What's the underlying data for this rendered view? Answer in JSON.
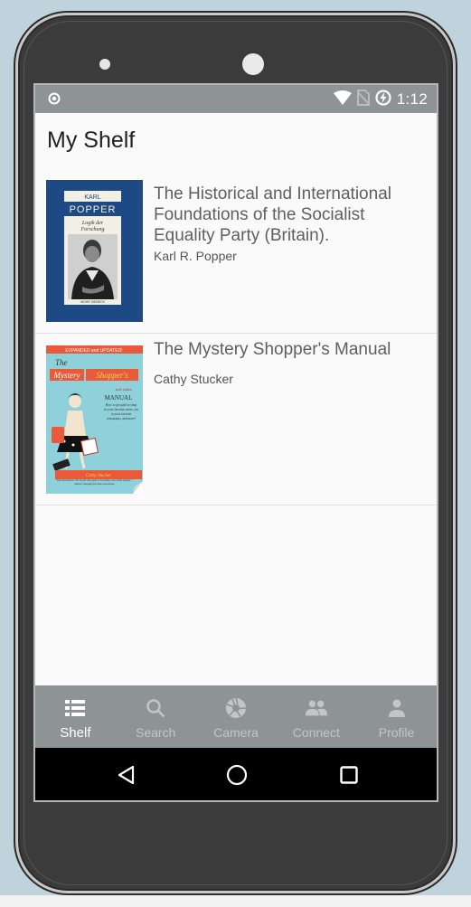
{
  "status_bar": {
    "time": "1:12"
  },
  "page": {
    "title": "My Shelf"
  },
  "books": [
    {
      "title": "The Historical and International Foundations of the Socialist Equality Party (Britain).",
      "author": "Karl R. Popper",
      "cover": {
        "author_top": "KARL",
        "author_name": "POPPER",
        "subtitle_1": "Logik der",
        "subtitle_2": "Forschung",
        "publisher": "MOHR SIEBECK",
        "background": "#1e4b86"
      }
    },
    {
      "title": "The Mystery Shopper's Manual",
      "author": "Cathy Stucker",
      "cover": {
        "banner": "EXPANDED and UPDATED!",
        "the": "The",
        "mystery": "Mystery",
        "shoppers": "Shopper's",
        "manual": "MANUAL",
        "edition": "sixth edition",
        "blurb": "How to get paid to shop in your favorite stores, eat in your favorite restaurants, and more!",
        "byline": "Cathy Stucker",
        "quote": "\"Solid information. The top-flit only guide to becoming a successful shopper.\" - Mystery Shopping Providers Association",
        "background": "#8fd1da"
      }
    }
  ],
  "bottom_nav": [
    {
      "label": "Shelf",
      "icon": "shelf-list-icon",
      "active": true
    },
    {
      "label": "Search",
      "icon": "search-icon",
      "active": false
    },
    {
      "label": "Camera",
      "icon": "camera-aperture-icon",
      "active": false
    },
    {
      "label": "Connect",
      "icon": "people-icon",
      "active": false
    },
    {
      "label": "Profile",
      "icon": "person-icon",
      "active": false
    }
  ],
  "system_nav": {
    "back": "back-triangle-icon",
    "home": "home-circle-icon",
    "recents": "recents-square-icon"
  },
  "colors": {
    "bar": "#8e9396",
    "active_label": "#ffffff",
    "inactive_label": "#c2c6c8"
  }
}
